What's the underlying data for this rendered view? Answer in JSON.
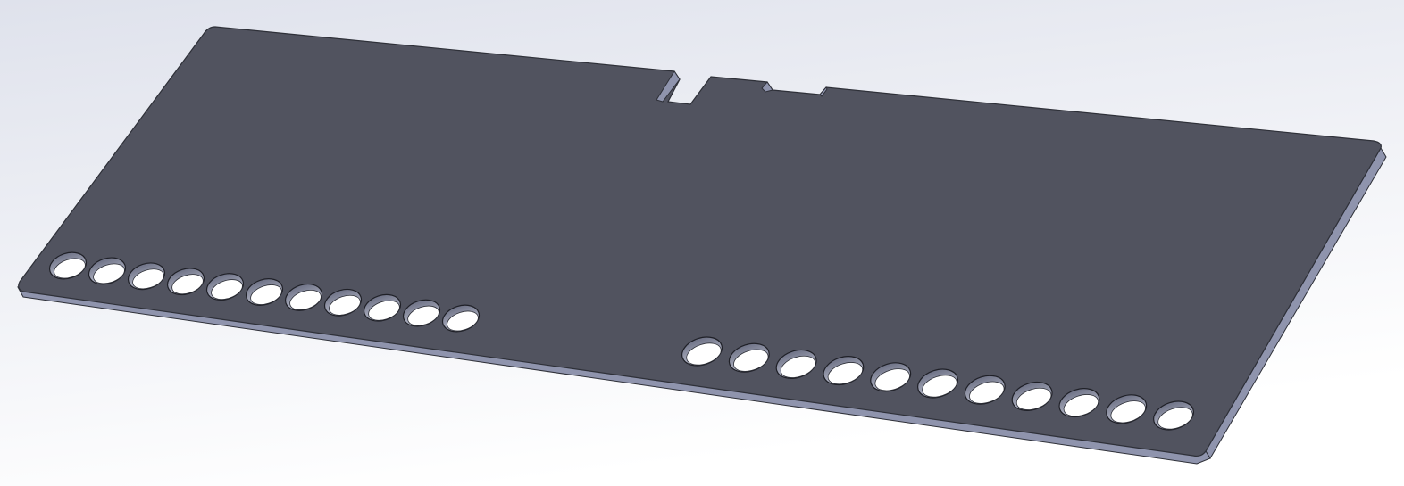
{
  "viewport": {
    "background_top": "#dfe2ec",
    "background_bottom": "#ffffff"
  },
  "part": {
    "face_color": "#51535f",
    "edge_color": "#8f94ad",
    "edge_dark": "#2e3038",
    "hole_wall_color": "#a7abc2",
    "hole_rows": [
      {
        "count": 11
      },
      {
        "count": 11
      }
    ]
  }
}
